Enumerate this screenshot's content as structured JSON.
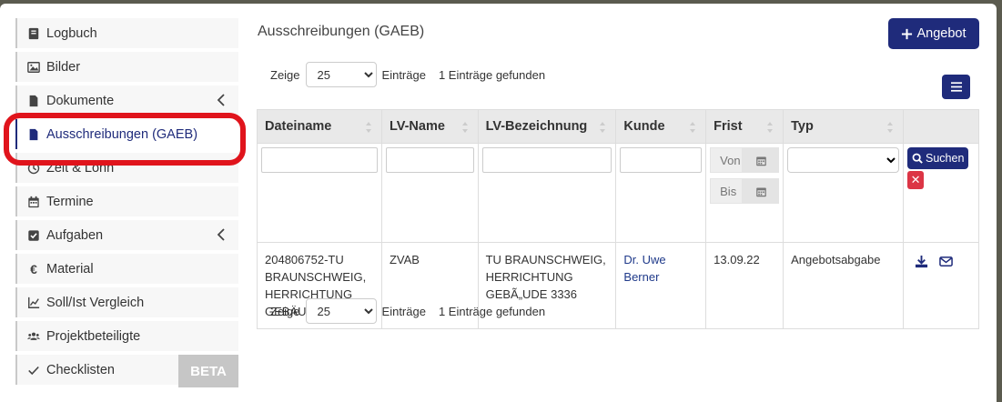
{
  "sidebar": {
    "items": [
      {
        "label": "Logbuch",
        "icon": "book-icon"
      },
      {
        "label": "Bilder",
        "icon": "image-icon"
      },
      {
        "label": "Dokumente",
        "icon": "file-icon"
      },
      {
        "label": "Ausschreibungen (GAEB)",
        "icon": "file-icon"
      },
      {
        "label": "Zeit & Lohn",
        "icon": "clock-icon"
      },
      {
        "label": "Termine",
        "icon": "calendar-icon"
      },
      {
        "label": "Aufgaben",
        "icon": "check-square-icon"
      },
      {
        "label": "Material",
        "icon": "euro-icon"
      },
      {
        "label": "Soll/Ist Vergleich",
        "icon": "chart-icon"
      },
      {
        "label": "Projektbeteiligte",
        "icon": "users-icon"
      },
      {
        "label": "Checklisten",
        "icon": "check-icon"
      }
    ],
    "beta_label": "BETA"
  },
  "main": {
    "title": "Ausschreibungen (GAEB)",
    "add_button": "Angebot",
    "length": {
      "prefix": "Zeige",
      "value": "25",
      "suffix": "Einträge",
      "found": "1 Einträge gefunden"
    },
    "columns": [
      "Dateiname",
      "LV-Name",
      "LV-Bezeichnung",
      "Kunde",
      "Frist",
      "Typ"
    ],
    "filters": {
      "date_from_placeholder": "Von",
      "date_to_placeholder": "Bis",
      "search_button": "Suchen",
      "clear_button": "✕"
    },
    "rows": [
      {
        "dateiname": "204806752-TU BRAUNSCHWEIG, HERRICHTUNG GEBÄUDE 333.P94",
        "lv_name": "ZVAB",
        "lv_bezeichnung": "TU BRAUNSCHWEIG, HERRICHTUNG GEBÃ„UDE 3336",
        "kunde": "Dr. Uwe Berner",
        "frist": "13.09.22",
        "typ": "Angebotsabgabe"
      }
    ]
  },
  "colors": {
    "primary": "#1f2b7b",
    "highlight": "#e0141c",
    "danger": "#dc3545",
    "beta": "#c6c6c6"
  }
}
